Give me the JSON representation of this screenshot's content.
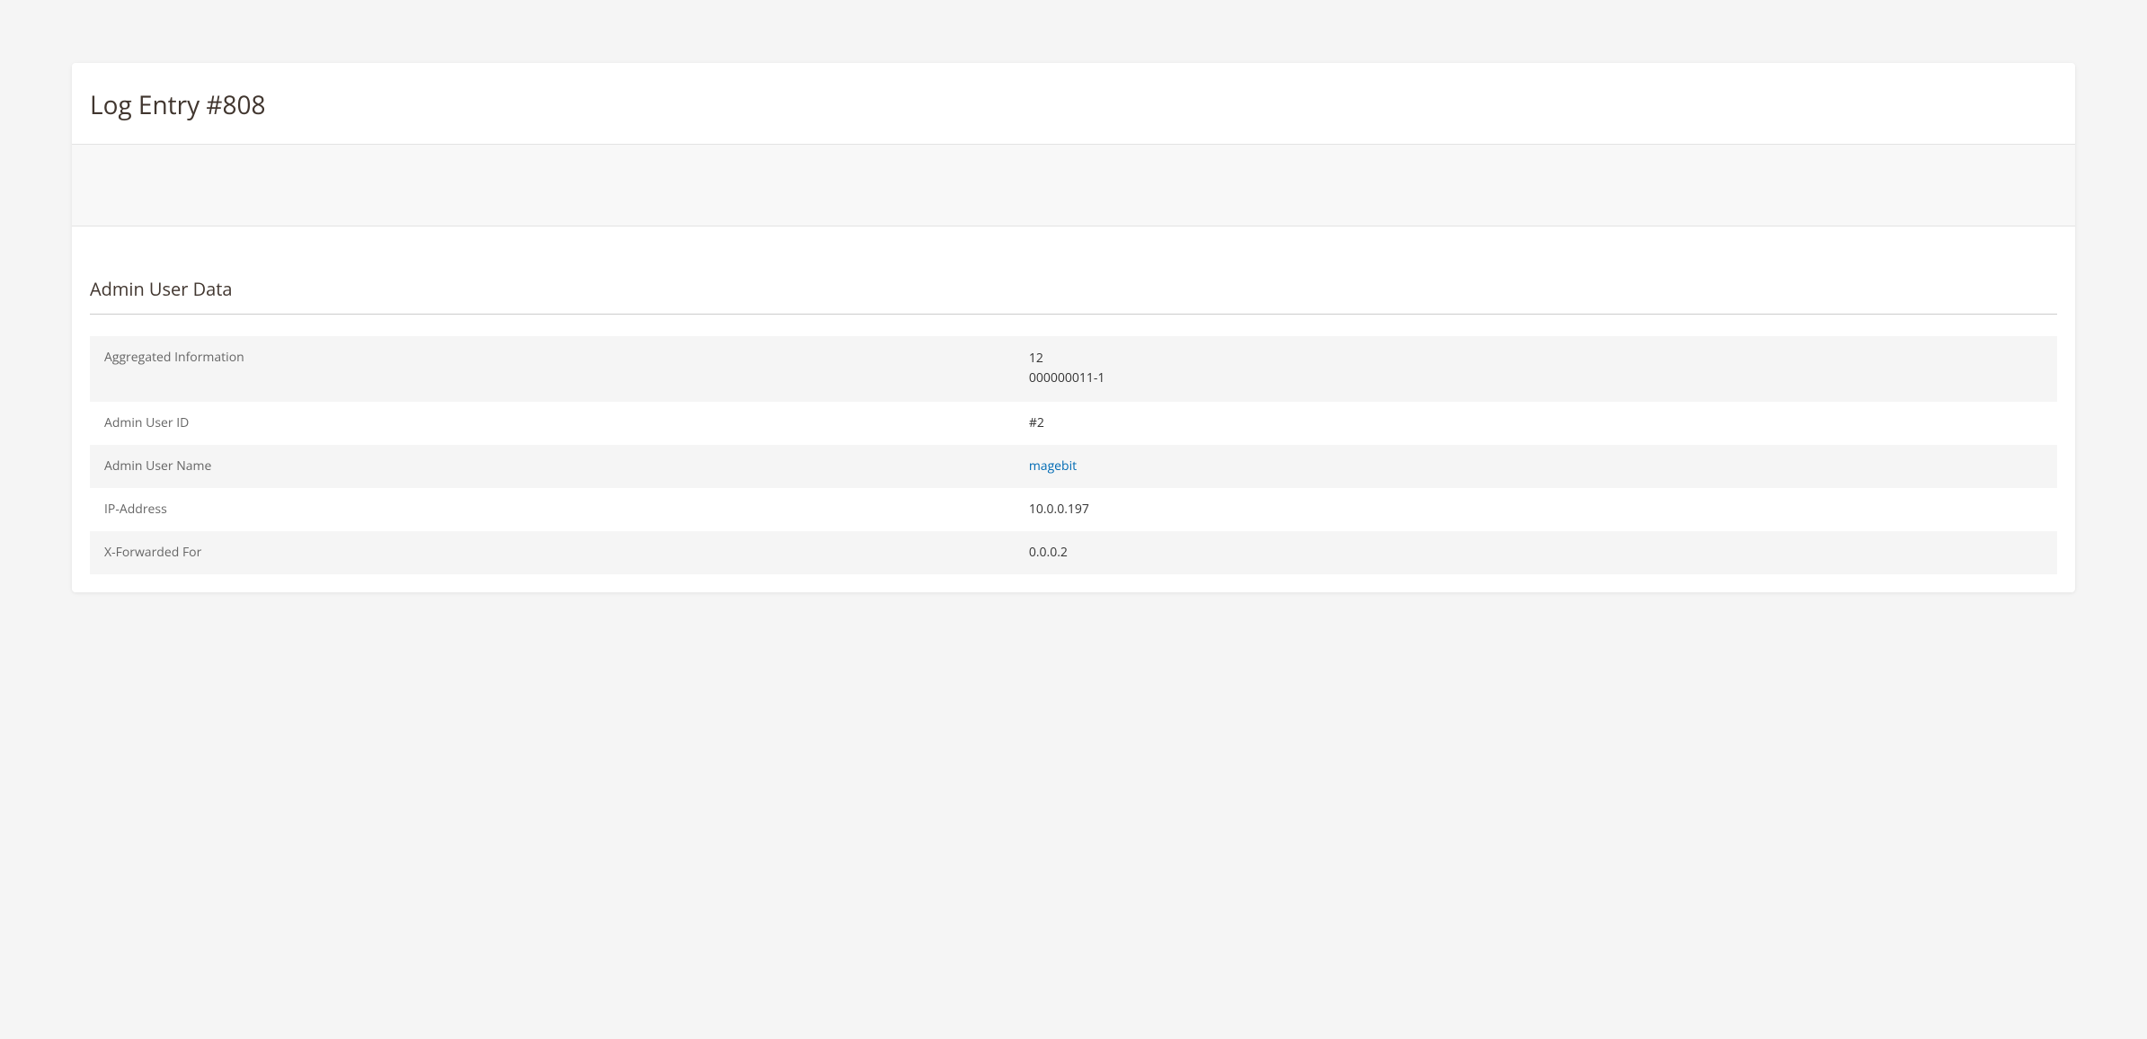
{
  "page_title": "Log Entry #808",
  "section_title": "Admin User Data",
  "rows": {
    "aggregated": {
      "label": "Aggregated Information",
      "value": "12\n000000011-1"
    },
    "admin_user_id": {
      "label": "Admin User ID",
      "value": "#2"
    },
    "admin_user_name": {
      "label": "Admin User Name",
      "value": "magebit"
    },
    "ip_address": {
      "label": "IP-Address",
      "value": "10.0.0.197"
    },
    "x_forwarded_for": {
      "label": "X-Forwarded For",
      "value": "0.0.0.2"
    }
  }
}
